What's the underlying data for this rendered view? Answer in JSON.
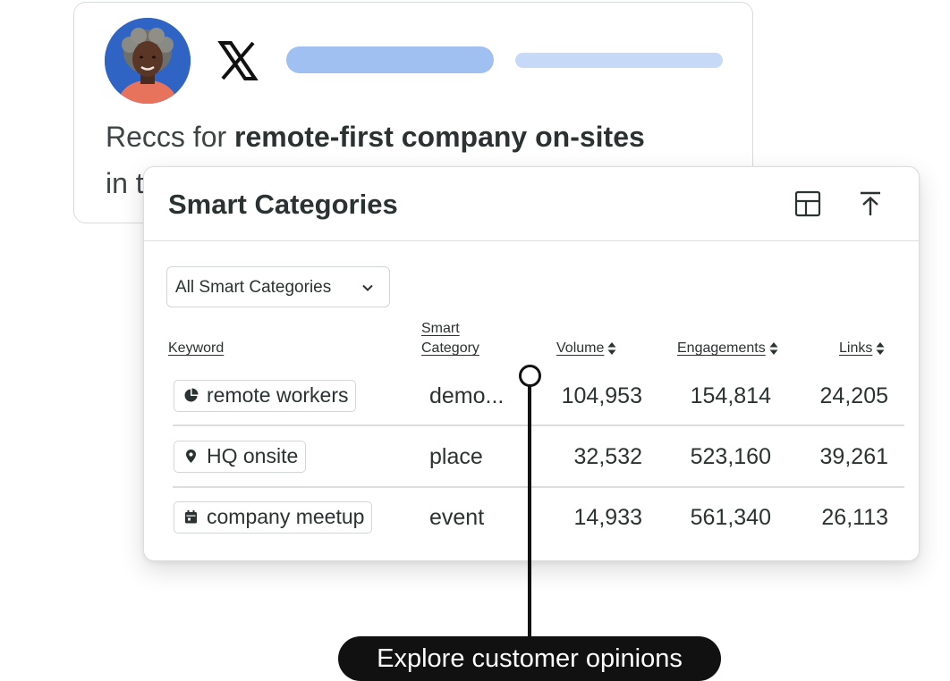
{
  "tweet": {
    "prefix": "Reccs for ",
    "bold": "remote-first company on-sites",
    "line2": "in t",
    "platform_icon": "x-logo-icon"
  },
  "panel": {
    "title": "Smart Categories",
    "icons": [
      "table-icon",
      "export-icon"
    ],
    "filter_label": "All Smart Categories",
    "columns": {
      "keyword": "Keyword",
      "smart_line1": "Smart",
      "smart_line2": "Category",
      "volume": "Volume",
      "engagements": "Engagements",
      "links": "Links"
    },
    "rows": [
      {
        "icon": "pie-chart-icon",
        "keyword": "remote workers",
        "category": "demo...",
        "volume": "104,953",
        "engagements": "154,814",
        "links": "24,205"
      },
      {
        "icon": "location-pin-icon",
        "keyword": "HQ onsite",
        "category": "place",
        "volume": "32,532",
        "engagements": "523,160",
        "links": "39,261"
      },
      {
        "icon": "calendar-icon",
        "keyword": "company meetup",
        "category": "event",
        "volume": "14,933",
        "engagements": "561,340",
        "links": "26,113"
      }
    ]
  },
  "callout": {
    "label": "Explore customer opinions"
  },
  "colors": {
    "accent_bar": "#9fc0f0",
    "accent_bar_light": "#c6daf7",
    "avatar_bg": "#2f64c4",
    "callout_bg": "#111111"
  }
}
